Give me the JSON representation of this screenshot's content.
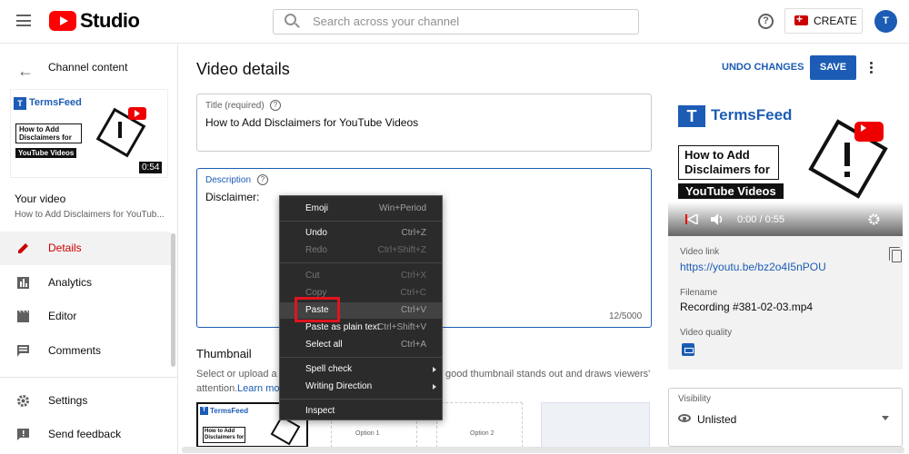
{
  "header": {
    "brand": "Studio",
    "search_placeholder": "Search across your channel",
    "help": "?",
    "create_label": "CREATE",
    "avatar_letter": "T"
  },
  "sidebar": {
    "back_label": "Channel content",
    "thumb": {
      "brand": "TermsFeed",
      "line1": "How to Add",
      "line2": "Disclaimers for",
      "line3": "YouTube Videos",
      "duration": "0:54"
    },
    "your_video": "Your video",
    "video_title": "How to Add Disclaimers for YouTub...",
    "items": [
      {
        "label": "Details"
      },
      {
        "label": "Analytics"
      },
      {
        "label": "Editor"
      },
      {
        "label": "Comments"
      },
      {
        "label": "Settings"
      },
      {
        "label": "Send feedback"
      }
    ]
  },
  "main": {
    "page_title": "Video details",
    "undo_label": "UNDO CHANGES",
    "save_label": "SAVE",
    "title_field": {
      "label": "Title (required)",
      "value": "How to Add Disclaimers for YouTube Videos"
    },
    "description_field": {
      "label": "Description",
      "value": "Disclaimer:",
      "counter": "12/5000"
    },
    "thumbnail": {
      "heading": "Thumbnail",
      "desc_start": "Select or upload a p",
      "desc_end": "good thumbnail stands out and draws viewers'",
      "desc_line2": "attention.",
      "learn_more": "Learn mor",
      "option1": "Option 1",
      "option2": "Option 2"
    }
  },
  "right_panel": {
    "preview": {
      "brand": "TermsFeed",
      "line1": "How to Add",
      "line2": "Disclaimers for",
      "line3": "YouTube Videos",
      "time": "0:00 / 0:55"
    },
    "video_link_label": "Video link",
    "video_link": "https://youtu.be/bz2o4I5nPOU",
    "filename_label": "Filename",
    "filename": "Recording #381-02-03.mp4",
    "quality_label": "Video quality",
    "visibility_label": "Visibility",
    "visibility_value": "Unlisted"
  },
  "context_menu": {
    "items": [
      {
        "label": "Emoji",
        "shortcut": "Win+Period",
        "enabled": true
      },
      {
        "label": "Undo",
        "shortcut": "Ctrl+Z",
        "enabled": true
      },
      {
        "label": "Redo",
        "shortcut": "Ctrl+Shift+Z",
        "enabled": false
      },
      {
        "label": "Cut",
        "shortcut": "Ctrl+X",
        "enabled": false
      },
      {
        "label": "Copy",
        "shortcut": "Ctrl+C",
        "enabled": false
      },
      {
        "label": "Paste",
        "shortcut": "Ctrl+V",
        "enabled": true,
        "highlighted": true
      },
      {
        "label": "Paste as plain text",
        "shortcut": "Ctrl+Shift+V",
        "enabled": true
      },
      {
        "label": "Select all",
        "shortcut": "Ctrl+A",
        "enabled": true
      },
      {
        "label": "Spell check",
        "shortcut": "",
        "submenu": true
      },
      {
        "label": "Writing Direction",
        "shortcut": "",
        "submenu": true
      },
      {
        "label": "Inspect",
        "shortcut": "",
        "enabled": true
      }
    ]
  },
  "colors": {
    "accent": "#1c5cb5",
    "brand_red": "#ff0000",
    "highlight_box": "#e0141e"
  }
}
